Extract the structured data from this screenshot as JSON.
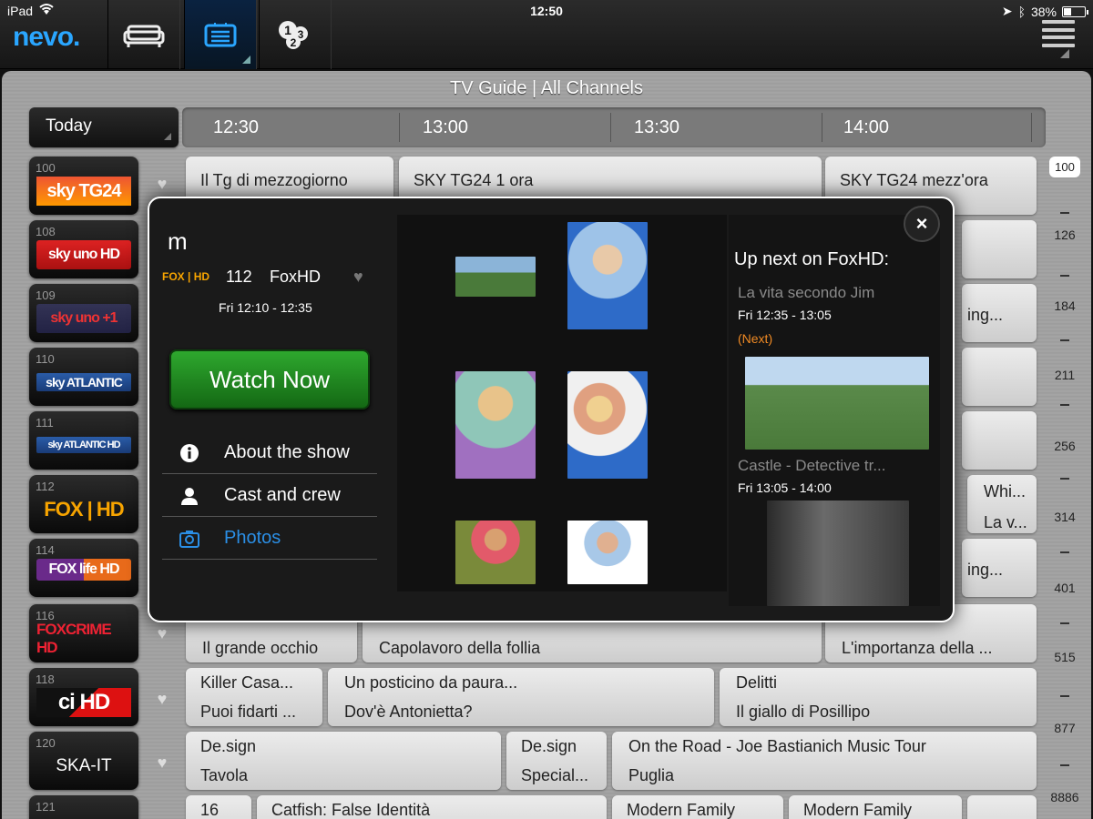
{
  "status": {
    "device": "iPad",
    "time": "12:50",
    "battery": "38%",
    "battery_level": 0.38
  },
  "app": {
    "logo": "nevo.",
    "nav_icons": [
      "sofa-icon",
      "tv-guide-icon",
      "numbers-icon",
      "menu-icon"
    ]
  },
  "guide": {
    "title": "TV Guide | All Channels",
    "day": "Today",
    "times": [
      "12:30",
      "13:00",
      "13:30",
      "14:00"
    ],
    "channels": [
      {
        "number": "100",
        "name": "sky TG24",
        "count": "100",
        "count_active": true,
        "programs": [
          {
            "l1": "",
            "l2": "Il Tg di mezzogiorno"
          },
          {
            "l1": "",
            "l2": "SKY TG24 1 ora"
          },
          {
            "l1": "",
            "l2": "SKY TG24 mezz'ora"
          }
        ]
      },
      {
        "number": "108",
        "name": "sky uno HD",
        "count": "126"
      },
      {
        "number": "109",
        "name": "sky uno +1",
        "count": "184",
        "programs": [
          {
            "l1": "",
            "l2": "ing..."
          }
        ]
      },
      {
        "number": "110",
        "name": "sky ATLANTIC",
        "count": "211"
      },
      {
        "number": "111",
        "name": "sky ATLANTIC HD",
        "count": "256"
      },
      {
        "number": "112",
        "name": "FOX | HD",
        "count": "314",
        "programs": [
          {
            "l1": "Whi...",
            "l2": "La v..."
          }
        ]
      },
      {
        "number": "114",
        "name": "FOX life HD",
        "count": "401",
        "programs": [
          {
            "l1": "",
            "l2": "ing..."
          }
        ]
      },
      {
        "number": "116",
        "name": "FOXCRIME HD",
        "count": "515",
        "programs": [
          {
            "l1": "",
            "l2": "Il grande occhio"
          },
          {
            "l1": "",
            "l2": "Capolavoro della follia"
          },
          {
            "l1": "",
            "l2": "L'importanza della ..."
          }
        ]
      },
      {
        "number": "118",
        "name": "ci HD",
        "count": "877",
        "programs": [
          {
            "l1": "Killer Casa...",
            "l2": "Puoi fidarti ..."
          },
          {
            "l1": "Un posticino da paura...",
            "l2": "Dov'è Antonietta?"
          },
          {
            "l1": "Delitti",
            "l2": "Il giallo di Posillipo"
          }
        ]
      },
      {
        "number": "120",
        "name": "SKA-IT",
        "count": "",
        "programs": [
          {
            "l1": "De.sign",
            "l2": "Tavola"
          },
          {
            "l1": "De.sign",
            "l2": "Special..."
          },
          {
            "l1": "On the Road - Joe Bastianich Music Tour",
            "l2": "Puglia"
          }
        ]
      },
      {
        "number": "121",
        "name": "",
        "count": "8886",
        "programs": [
          {
            "l1": "16",
            "l2": ""
          },
          {
            "l1": "Catfish: False Identità",
            "l2": ""
          },
          {
            "l1": "Modern Family",
            "l2": ""
          },
          {
            "l1": "Modern Family",
            "l2": ""
          }
        ]
      }
    ]
  },
  "popup": {
    "title": "m",
    "channel_logo": "FOX | HD",
    "channel_number": "112",
    "channel_name": "FoxHD",
    "time": "Fri 12:10 - 12:35",
    "watch_label": "Watch Now",
    "menu": [
      {
        "label": "About the show",
        "icon": "info-icon"
      },
      {
        "label": "Cast and crew",
        "icon": "person-icon"
      },
      {
        "label": "Photos",
        "icon": "camera-icon",
        "active": true
      }
    ],
    "up_next_title": "Up next on FoxHD:",
    "up_next": [
      {
        "show": "La vita secondo Jim",
        "time": "Fri 12:35 - 13:05",
        "tag": "(Next)"
      },
      {
        "show": "Castle - Detective tr...",
        "time": "Fri 13:05 - 14:00"
      }
    ],
    "close_label": "×"
  },
  "colors": {
    "accent": "#2aa6ff",
    "watch_green": "#2ea82e",
    "next_orange": "#f08a24",
    "active_blue": "#2b8fe6"
  }
}
